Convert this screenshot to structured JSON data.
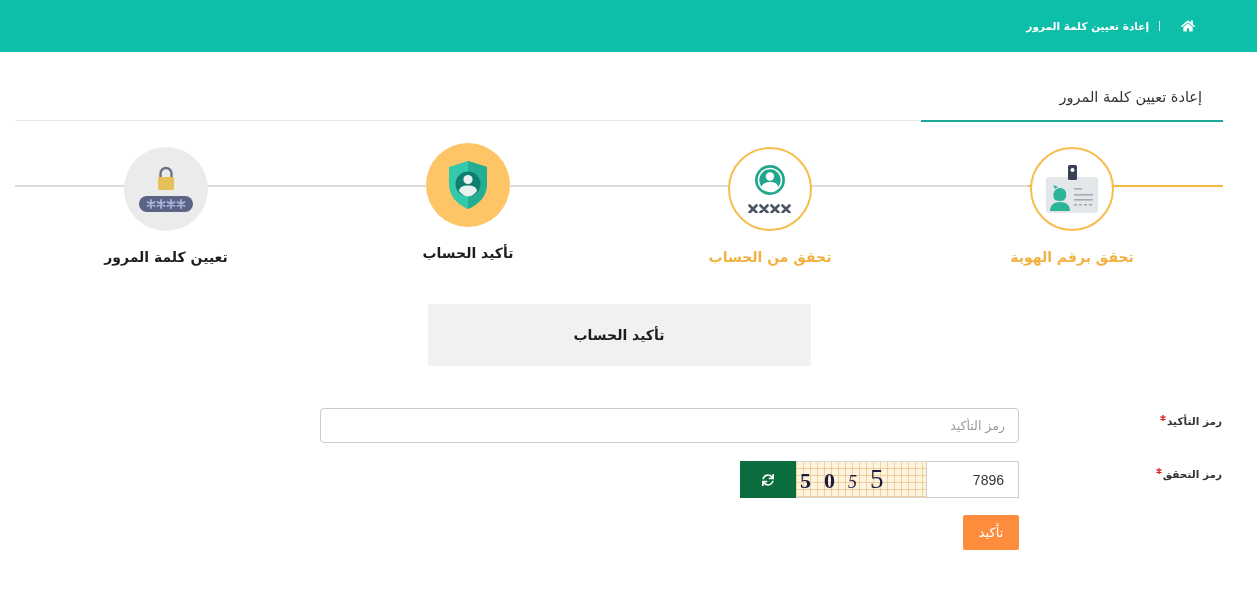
{
  "header": {
    "breadcrumb": {
      "current": "إعادة تعيين كلمة المرور"
    }
  },
  "page_title": "إعادة تعيين كلمة المرور",
  "steps": [
    {
      "label": "تحقق برقم الهوية",
      "completed": true,
      "selected": false
    },
    {
      "label": "تحقق من الحساب",
      "completed": true,
      "selected": false
    },
    {
      "label": "تأكيد الحساب",
      "completed": false,
      "selected": true
    },
    {
      "label": "تعيين كلمة المرور",
      "completed": false,
      "selected": false
    }
  ],
  "section": {
    "title": "تأكيد الحساب"
  },
  "form": {
    "fields": [
      {
        "kind": "text",
        "label": "رمز التأكيد",
        "required": true,
        "placeholder": "رمز التأكيد"
      },
      {
        "kind": "captcha",
        "label": "رمز التحقق",
        "required": true,
        "value": "7896",
        "captcha_code": "5 0 5 5"
      }
    ],
    "submit": "تأكيد"
  }
}
